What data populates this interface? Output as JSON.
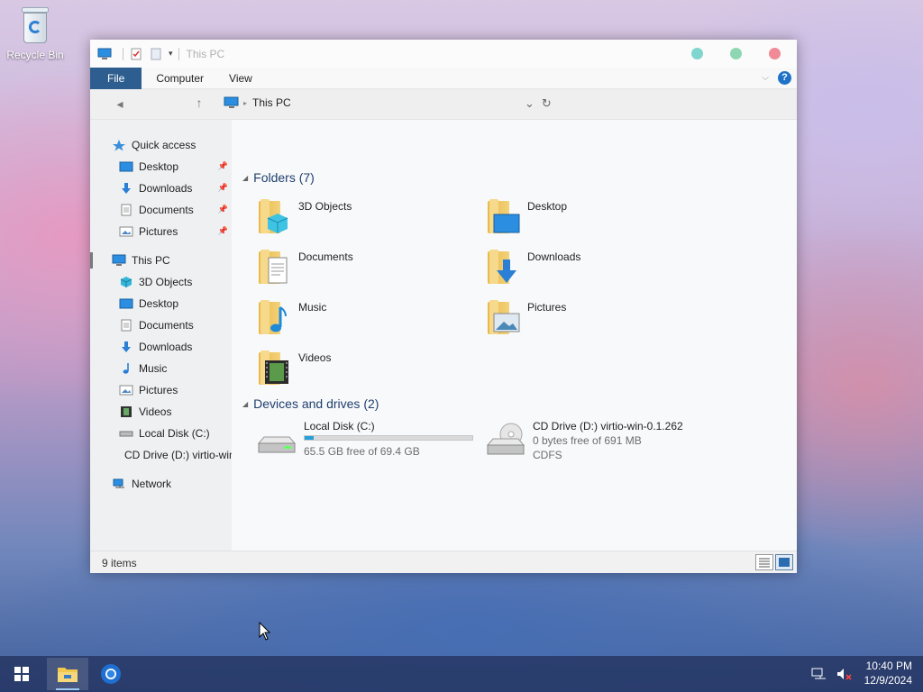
{
  "desktop": {
    "recycle_bin_label": "Recycle Bin"
  },
  "window": {
    "title": "This PC",
    "controls_colors": [
      "#7fd6cf",
      "#8ed7b2",
      "#f08a96"
    ]
  },
  "ribbon": {
    "tabs": [
      "File",
      "Computer",
      "View"
    ],
    "file_color": "#2e5e8f"
  },
  "address": {
    "location": "This PC"
  },
  "nav": {
    "quick_access": "Quick access",
    "quick_items": [
      "Desktop",
      "Downloads",
      "Documents",
      "Pictures"
    ],
    "this_pc": "This PC",
    "pc_items": [
      "3D Objects",
      "Desktop",
      "Documents",
      "Downloads",
      "Music",
      "Pictures",
      "Videos",
      "Local Disk (C:)",
      "CD Drive (D:) virtio-win-0.1.262"
    ],
    "network": "Network"
  },
  "folders": {
    "heading": "Folders (7)",
    "items": [
      "3D Objects",
      "Desktop",
      "Documents",
      "Downloads",
      "Music",
      "Pictures",
      "Videos"
    ]
  },
  "drives": {
    "heading": "Devices and drives (2)",
    "c": {
      "name": "Local Disk (C:)",
      "free": "65.5 GB free of 69.4 GB",
      "used_fraction": 0.056
    },
    "d": {
      "name": "CD Drive (D:) virtio-win-0.1.262",
      "free": "0 bytes free of 691 MB",
      "fs": "CDFS"
    }
  },
  "status": {
    "items_count": "9 items"
  },
  "taskbar": {
    "time": "10:40 PM",
    "date": "12/9/2024"
  }
}
